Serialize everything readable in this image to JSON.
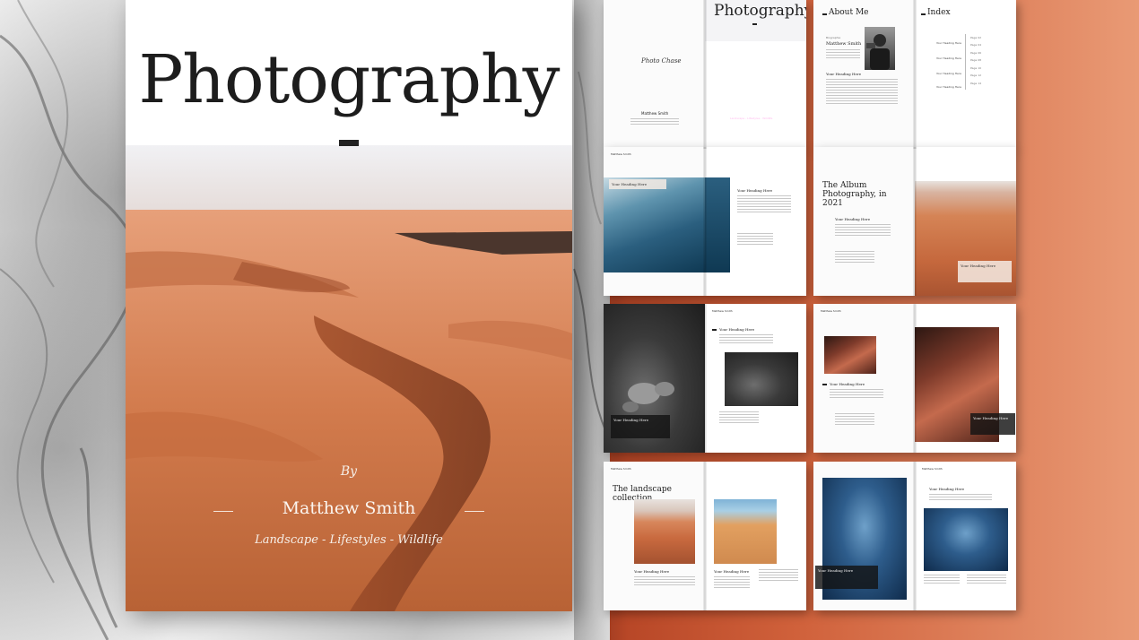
{
  "cover": {
    "title": "Photography",
    "by": "By",
    "author": "Matthew Smith",
    "tagline": "Landscape - Lifestyles - Wildlife"
  },
  "spreads": {
    "s1": {
      "signature": "Photo Chase",
      "name": "Matthew Smith",
      "right_title": "Photography",
      "right_author": "Matthew Smith",
      "right_tags": "Landscape - Lifestyles - Wildlife"
    },
    "s2": {
      "title": "About Me",
      "sub": "Biographie",
      "name": "Matthew Smith",
      "heading": "Your Heading Here",
      "index_title": "Index",
      "index_items": [
        "Your Heading Here",
        "Your Heading Here",
        "Your Heading Here",
        "Your Heading Here"
      ],
      "index_pages": [
        "Page 02",
        "Page 04",
        "Page 06",
        "Page 08",
        "Page 10",
        "Page 12",
        "Page 14"
      ]
    },
    "s3": {
      "header": "Matthew Smith",
      "caption": "Your Heading Here",
      "heading": "Your Heading Here"
    },
    "s4": {
      "title": "The Album Photography, in 2021",
      "heading": "Your Heading Here",
      "caption": "Your Heading Here"
    },
    "s5": {
      "header": "Matthew Smith",
      "caption": "Your Heading Here",
      "heading": "Your Heading Here"
    },
    "s6": {
      "header": "Matthew Smith",
      "heading": "Your Heading Here",
      "caption": "Your Heading Here"
    },
    "s7": {
      "header": "Matthew Smith",
      "title": "The landscape collection",
      "heading_left": "Your Heading Here",
      "heading_right": "Your Heading Here"
    },
    "s8": {
      "header": "Matthew Smith",
      "caption": "Your Heading Here",
      "heading": "Your Heading Here"
    }
  }
}
